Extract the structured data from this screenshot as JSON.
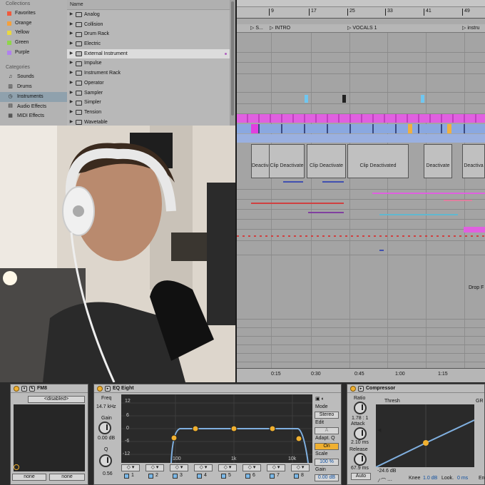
{
  "browser": {
    "collections_header": "Collections",
    "collections": [
      {
        "label": "Favorites",
        "color": "#f05a3c"
      },
      {
        "label": "Orange",
        "color": "#f5a03c"
      },
      {
        "label": "Yellow",
        "color": "#e8d840"
      },
      {
        "label": "Green",
        "color": "#8fd648"
      },
      {
        "label": "Purple",
        "color": "#b080f0"
      }
    ],
    "categories_header": "Categories",
    "categories": [
      {
        "label": "Sounds",
        "icon": "music-note-icon"
      },
      {
        "label": "Drums",
        "icon": "drums-icon"
      },
      {
        "label": "Instruments",
        "icon": "clock-icon"
      },
      {
        "label": "Audio Effects",
        "icon": "audio-effects-icon"
      },
      {
        "label": "MIDI Effects",
        "icon": "midi-effects-icon"
      }
    ],
    "name_header": "Name",
    "items": [
      "Analog",
      "Collision",
      "Drum Rack",
      "Electric",
      "External Instrument",
      "Impulse",
      "Instrument Rack",
      "Operator",
      "Sampler",
      "Simpler",
      "Tension",
      "Wavetable"
    ]
  },
  "arrangement": {
    "bars": [
      "9",
      "17",
      "25",
      "33",
      "41",
      "49"
    ],
    "locators": [
      "S...",
      "INTRO",
      "VOCALS 1",
      "instru"
    ],
    "clip_labels": [
      "Deactivat",
      "Clip Deactivate",
      "Clip Deactivate",
      "Clip Deactivated",
      "Deactivate",
      "Deactiva"
    ],
    "drop_label": "Drop F",
    "times": [
      "0:15",
      "0:30",
      "0:45",
      "1:00",
      "1:15"
    ]
  },
  "fm8": {
    "title": "FM8",
    "preset": "<disabled>",
    "left_field": "none",
    "right_field": "none"
  },
  "eq": {
    "title": "EQ Eight",
    "freq_label": "Freq",
    "freq_value": "14.7 kHz",
    "gain_label": "Gain",
    "gain_value": "0.00 dB",
    "q_label": "Q",
    "q_value": "0.56",
    "y_ticks": [
      "12",
      "6",
      "0",
      "-6",
      "-12"
    ],
    "x_ticks": [
      "100",
      "1k",
      "10k"
    ],
    "bands": [
      "1",
      "2",
      "3",
      "4",
      "5",
      "6",
      "7",
      "8"
    ],
    "mode_label": "Mode",
    "mode_value": "Stereo",
    "edit_label": "Edit",
    "edit_value": "A",
    "adaptq_label": "Adapt. Q",
    "adaptq_value": "On",
    "scale_label": "Scale",
    "scale_value": "100 %",
    "out_gain_label": "Gain",
    "out_gain_value": "0.00 dB"
  },
  "comp": {
    "title": "Compressor",
    "ratio_label": "Ratio",
    "ratio_value": "1.78 : 1",
    "attack_label": "Attack",
    "attack_value": "2.10 ms",
    "release_label": "Release",
    "release_value": "67.9 ms",
    "auto_label": "Auto",
    "thresh_label": "Thresh",
    "gr_label": "GR",
    "thresh_value": "-24.6 dB",
    "knee_label": "Knee",
    "knee_value": "1.0 dB",
    "look_label": "Look.",
    "look_value": "0 ms",
    "env_label": "En"
  }
}
